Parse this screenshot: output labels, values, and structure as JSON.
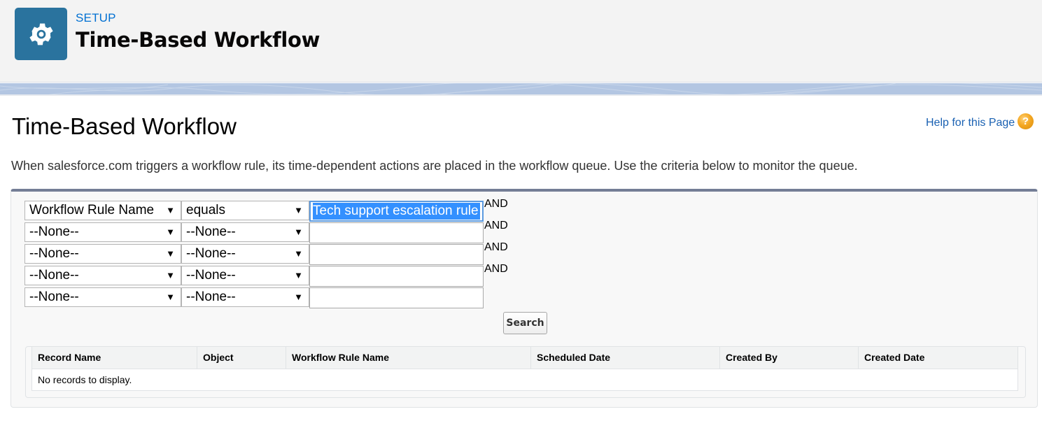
{
  "header": {
    "setup_label": "SETUP",
    "title": "Time-Based Workflow",
    "icon": "gear-icon"
  },
  "page": {
    "title": "Time-Based Workflow",
    "help_link": "Help for this Page",
    "help_icon": "?",
    "description": "When salesforce.com triggers a workflow rule, its time-dependent actions are placed in the workflow queue. Use the criteria below to monitor the queue."
  },
  "criteria": {
    "dropdown_arrow": "▼",
    "rows": [
      {
        "field": "Workflow Rule Name",
        "operator": "equals",
        "value": "Tech support escalation rule",
        "connector": "AND"
      },
      {
        "field": "--None--",
        "operator": "--None--",
        "value": "",
        "connector": "AND"
      },
      {
        "field": "--None--",
        "operator": "--None--",
        "value": "",
        "connector": "AND"
      },
      {
        "field": "--None--",
        "operator": "--None--",
        "value": "",
        "connector": "AND"
      },
      {
        "field": "--None--",
        "operator": "--None--",
        "value": "",
        "connector": ""
      }
    ],
    "search_label": "Search"
  },
  "results": {
    "columns": [
      "Record Name",
      "Object",
      "Workflow Rule Name",
      "Scheduled Date",
      "Created By",
      "Created Date"
    ],
    "empty_message": "No records to display."
  }
}
